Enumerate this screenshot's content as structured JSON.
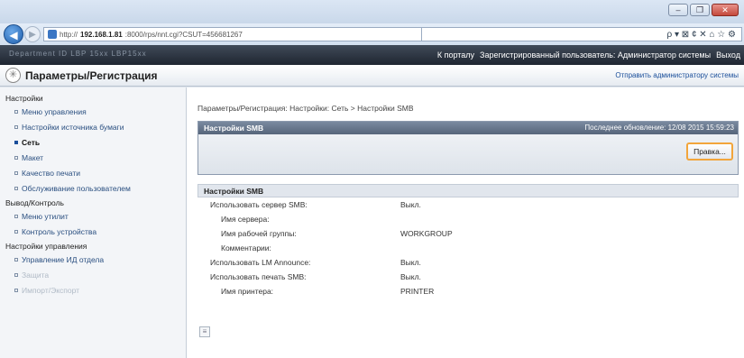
{
  "browser": {
    "url_prefix": "http://",
    "url_host": "192.168.1.81",
    "url_rest": ":8000/rps/nnt.cgi?CSUT=456681267",
    "search_controls": "ρ ▾ ⊠ ¢ ✕  ⌂ ☆ ⚙",
    "window_buttons": [
      "–",
      "❐",
      "✕"
    ]
  },
  "topband": {
    "left_text": "Department ID   LBP 15xx  LBP15xx",
    "links": [
      "К порталу",
      "Зарегистрированный пользователь: Администратор системы",
      "Выход"
    ]
  },
  "header": {
    "title": "Параметры/Регистрация",
    "mail_link": "Отправить администратору системы"
  },
  "sidebar": {
    "sections": [
      {
        "title": "Настройки",
        "items": [
          {
            "label": "Меню управления",
            "active": false
          },
          {
            "label": "Настройки источника бумаги",
            "active": false
          },
          {
            "label": "Сеть",
            "active": true
          },
          {
            "label": "Макет",
            "active": false
          },
          {
            "label": "Качество печати",
            "active": false
          },
          {
            "label": "Обслуживание пользователем",
            "active": false
          }
        ]
      },
      {
        "title": "Вывод/Контроль",
        "items": [
          {
            "label": "Меню утилит",
            "active": false
          },
          {
            "label": "Контроль устройства",
            "active": false
          }
        ]
      },
      {
        "title": "Настройки управления",
        "items": [
          {
            "label": "Управление ИД отдела",
            "active": false
          },
          {
            "label": "Защита",
            "active": false
          },
          {
            "label": "Импорт/Экспорт",
            "active": false
          }
        ]
      }
    ]
  },
  "main": {
    "breadcrumb": "Параметры/Регистрация: Настройки: Сеть > Настройки SMB",
    "section_title": "Настройки SMB",
    "last_updated": "Последнее обновление: 12/08 2015 15:59:23",
    "edit_button": "Правка...",
    "details_title": "Настройки SMB",
    "rows": [
      {
        "label": "Использовать сервер SMB:",
        "value": "Выкл.",
        "level": 1
      },
      {
        "label": "Имя сервера:",
        "value": "",
        "level": 2
      },
      {
        "label": "Имя рабочей группы:",
        "value": "WORKGROUP",
        "level": 2
      },
      {
        "label": "Комментарии:",
        "value": "",
        "level": 2
      },
      {
        "label": "Использовать LM Announce:",
        "value": "Выкл.",
        "level": 1
      },
      {
        "label": "Использовать печать SMB:",
        "value": "Выкл.",
        "level": 1
      },
      {
        "label": "Имя принтера:",
        "value": "PRINTER",
        "level": 2
      }
    ]
  },
  "colors": {
    "accent_orange": "#f2a53b",
    "top_band": "#1f2631",
    "link_blue": "#1a4e9a"
  }
}
